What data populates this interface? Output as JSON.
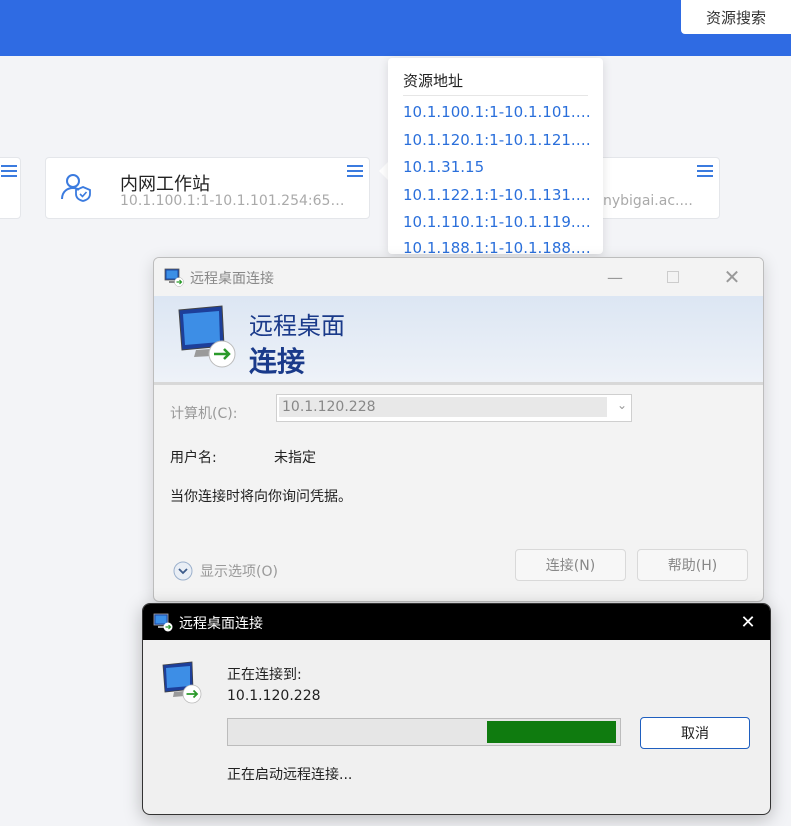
{
  "header": {
    "search_label": "资源搜索",
    "accent": "#2f6be3"
  },
  "cards": [
    {
      "title": "内网工作站",
      "subtitle": "10.1.100.1:1-10.1.101.254:655..."
    },
    {
      "subtitle_partial": "nybigai.ac...."
    }
  ],
  "popover": {
    "title": "资源地址",
    "items": [
      "10.1.100.1:1-10.1.101.25...",
      "10.1.120.1:1-10.1.121.25...",
      "10.1.31.15",
      "10.1.122.1:1-10.1.131.25...",
      "10.1.110.1:1-10.1.119.25...",
      "10.1.188.1:1-10.1.188.25"
    ]
  },
  "rdp_dialog": {
    "title": "远程桌面连接",
    "banner_line1": "远程桌面",
    "banner_line2": "连接",
    "computer_label": "计算机(C):",
    "computer_value": "10.1.120.228",
    "username_label": "用户名:",
    "username_value": "未指定",
    "note": "当你连接时将向你询问凭据。",
    "options_label": "显示选项(O)",
    "connect_label": "连接(N)",
    "help_label": "帮助(H)"
  },
  "progress_dialog": {
    "title": "远程桌面连接",
    "connecting_to": "正在连接到:",
    "address": "10.1.120.228",
    "status": "正在启动远程连接...",
    "cancel_label": "取消",
    "progress_start": 0.66,
    "progress_end": 0.99,
    "progress_color": "#0f7b0f"
  }
}
